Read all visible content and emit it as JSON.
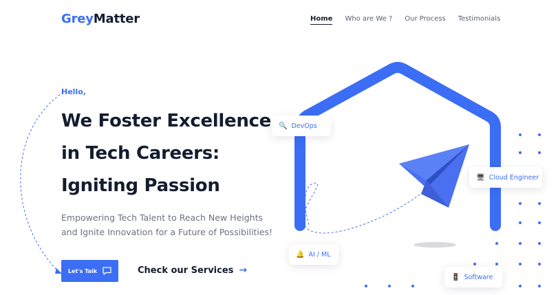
{
  "brand": {
    "part1": "Grey",
    "part2": "Matter"
  },
  "nav": [
    {
      "label": "Home",
      "active": true
    },
    {
      "label": "Who are We  ?",
      "active": false
    },
    {
      "label": "Our Process",
      "active": false
    },
    {
      "label": "Testimonials",
      "active": false
    }
  ],
  "hero": {
    "greeting": "Hello,",
    "headline": [
      "We Foster Excellence",
      "in Tech Careers:",
      "Igniting Passion"
    ],
    "subtext": "Empowering Tech Talent to Reach New Heights and Ignite Innovation for a Future of Possibilities!",
    "cta_primary": "Let's Talk",
    "cta_secondary": "Check our Services",
    "cta_secondary_arrow": "→"
  },
  "chips": {
    "devops": {
      "label": "DevOps",
      "icon": "magnifier-icon"
    },
    "cloud": {
      "label": "Cloud Engineer",
      "icon": "monitor-icon"
    },
    "ai": {
      "label": "AI / ML",
      "icon": "bell-icon"
    },
    "software": {
      "label": "Software",
      "icon": "traffic-light-icon"
    }
  },
  "colors": {
    "accent": "#3b6ef5",
    "text": "#141c2e",
    "muted": "#6c7080"
  }
}
